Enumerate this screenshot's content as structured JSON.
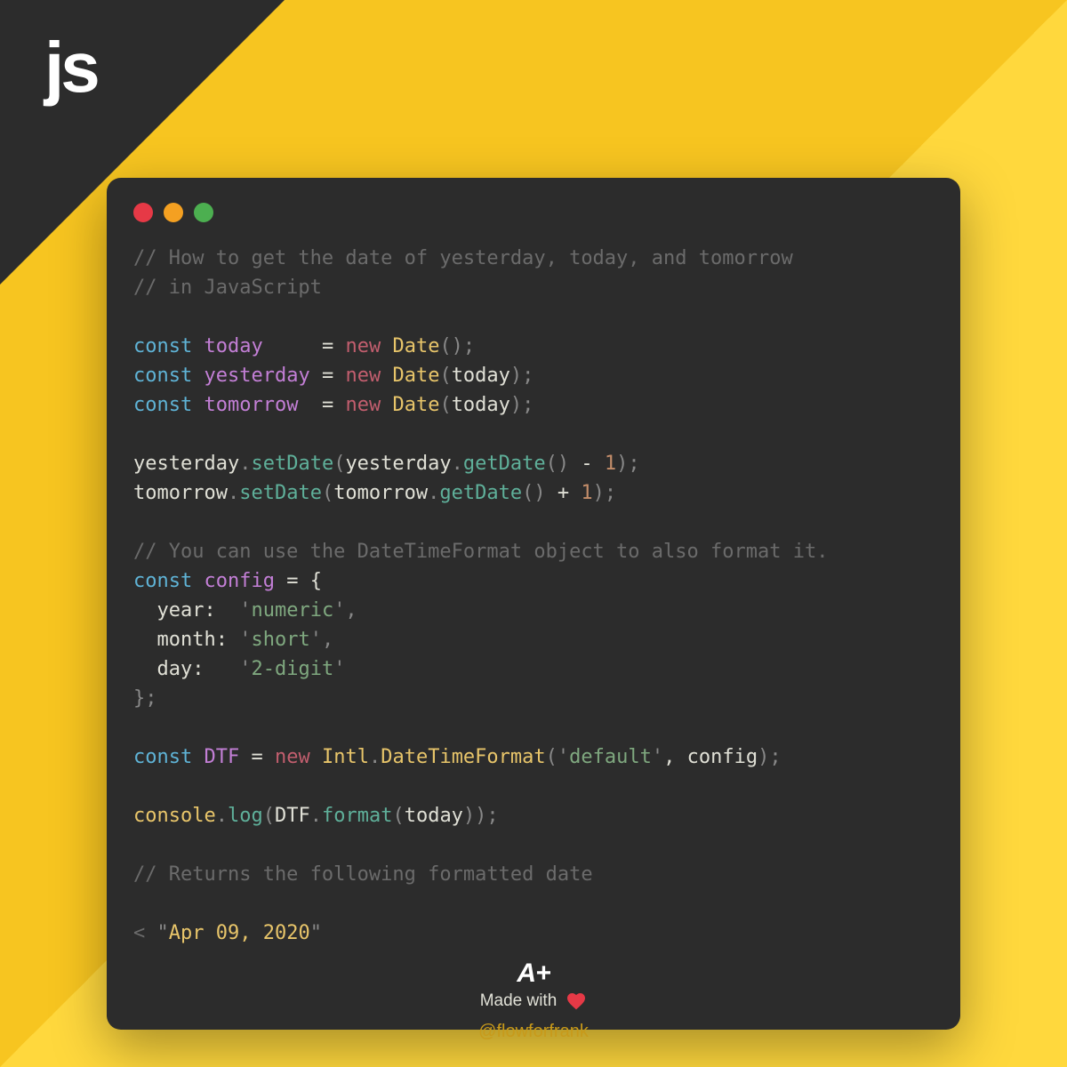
{
  "logo": "js",
  "code": {
    "comment1": "// How to get the date of yesterday, today, and tomorrow",
    "comment2": "// in JavaScript",
    "line3_kw": "const",
    "line3_var": "today",
    "line3_pad": "    ",
    "line3_eq": " = ",
    "line3_new": "new",
    "line3_cls": "Date",
    "line3_paren": "();",
    "line4_kw": "const",
    "line4_var": "yesterday",
    "line4_eq": " = ",
    "line4_new": "new",
    "line4_cls": "Date",
    "line4_p1": "(",
    "line4_arg": "today",
    "line4_p2": ");",
    "line5_kw": "const",
    "line5_var": "tomorrow",
    "line5_pad": " ",
    "line5_eq": " = ",
    "line5_new": "new",
    "line5_cls": "Date",
    "line5_p1": "(",
    "line5_arg": "today",
    "line5_p2": ");",
    "line6_var": "yesterday",
    "line6_dot": ".",
    "line6_fn": "setDate",
    "line6_p1": "(",
    "line6_var2": "yesterday",
    "line6_dot2": ".",
    "line6_fn2": "getDate",
    "line6_p2": "()",
    "line6_op": " - ",
    "line6_num": "1",
    "line6_p3": ");",
    "line7_var": "tomorrow",
    "line7_dot": ".",
    "line7_fn": "setDate",
    "line7_p1": "(",
    "line7_var2": "tomorrow",
    "line7_dot2": ".",
    "line7_fn2": "getDate",
    "line7_p2": "()",
    "line7_op": " + ",
    "line7_num": "1",
    "line7_p3": ");",
    "comment3": "// You can use the DateTimeFormat object to also format it.",
    "line9_kw": "const",
    "line9_var": "config",
    "line9_eq": " = {",
    "line10_key": "  year:  ",
    "line10_q1": "'",
    "line10_str": "numeric",
    "line10_q2": "',",
    "line11_key": "  month: ",
    "line11_q1": "'",
    "line11_str": "short",
    "line11_q2": "',",
    "line12_key": "  day:   ",
    "line12_q1": "'",
    "line12_str": "2-digit",
    "line12_q2": "'",
    "line13": "};",
    "line14_kw": "const",
    "line14_var": "DTF",
    "line14_eq": " = ",
    "line14_new": "new",
    "line14_intl": "Intl",
    "line14_dot": ".",
    "line14_cls": "DateTimeFormat",
    "line14_p1": "(",
    "line14_q1": "'",
    "line14_str": "default",
    "line14_q2": "'",
    "line14_comma": ", ",
    "line14_arg": "config",
    "line14_p2": ");",
    "line15_obj": "console",
    "line15_dot": ".",
    "line15_fn": "log",
    "line15_p1": "(",
    "line15_var": "DTF",
    "line15_dot2": ".",
    "line15_fn2": "format",
    "line15_p2": "(",
    "line15_arg": "today",
    "line15_p3": "));",
    "comment4": "// Returns the following formatted date",
    "out_arrow": "< ",
    "out_q1": "\"",
    "out_str": "Apr 09, 2020",
    "out_q2": "\""
  },
  "footer": {
    "logo": "A+",
    "madewith": "Made with"
  },
  "handle": "@flowforfrank"
}
